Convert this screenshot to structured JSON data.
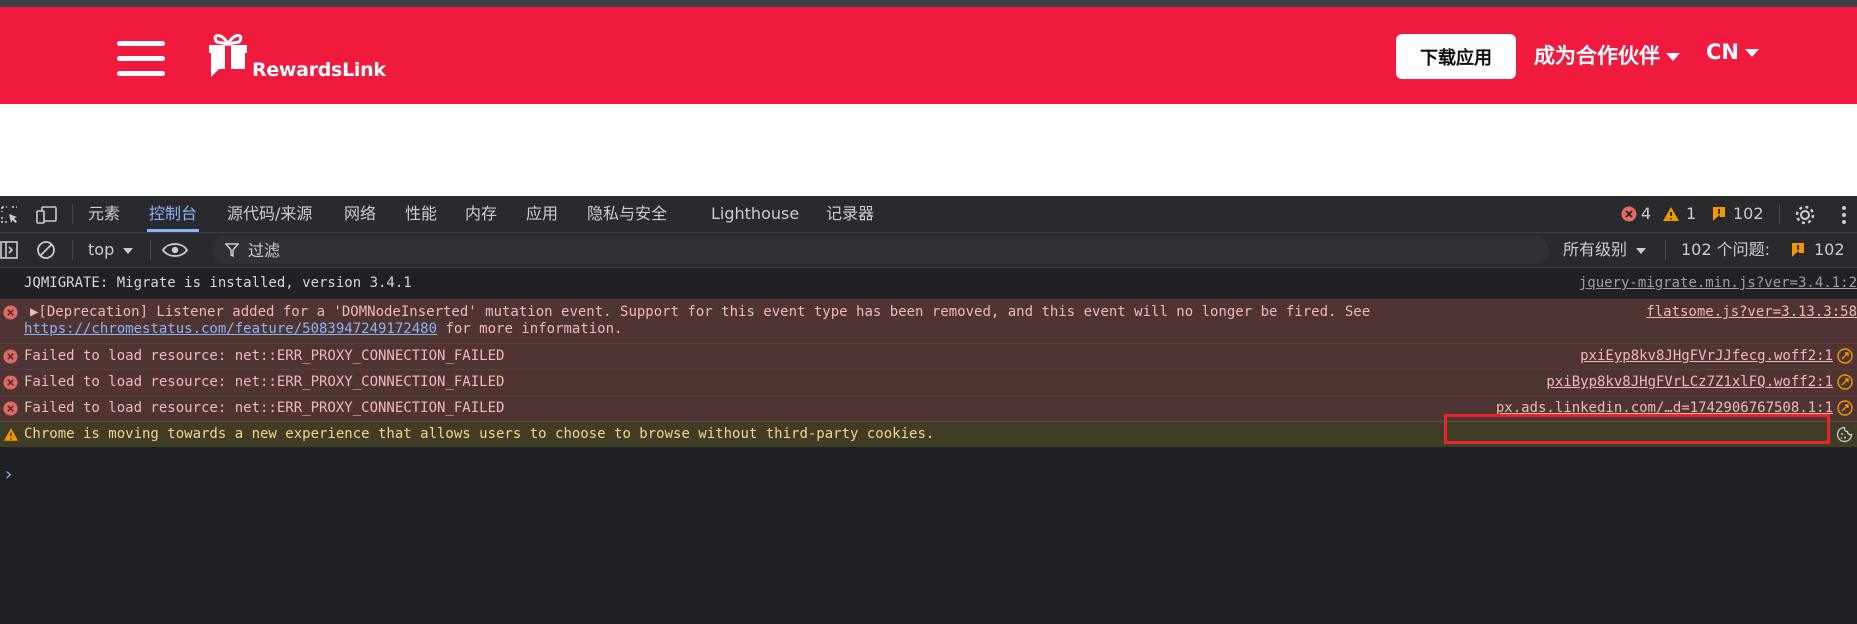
{
  "site": {
    "brand": "RewardsLink",
    "download_button": "下载应用",
    "partner_menu": "成为合作伙伴",
    "language": "CN",
    "colors": {
      "header": "#f0193e",
      "button_bg": "#ffffff"
    }
  },
  "devtools": {
    "tabs": [
      "元素",
      "控制台",
      "源代码/来源",
      "网络",
      "性能",
      "内存",
      "应用",
      "隐私与安全",
      "Lighthouse",
      "记录器"
    ],
    "active_tab": "控制台",
    "counts": {
      "errors": "4",
      "warnings": "1",
      "issues": "102"
    },
    "filterbar": {
      "context": "top",
      "filter_placeholder": "过滤",
      "level": "所有级别",
      "issues_label": "102 个问题:",
      "issues_count": "102"
    },
    "console": [
      {
        "level": "info",
        "text": "JQMIGRATE: Migrate is installed, version 3.4.1",
        "source": "jquery-migrate.min.js?ver=3.4.1:2"
      },
      {
        "level": "error",
        "text": "▶[Deprecation] Listener added for a 'DOMNodeInserted' mutation event. Support for this event type has been removed, and this event will no longer be fired. See",
        "link": "https://chromestatus.com/feature/5083947249172480",
        "after_link": " for more information.",
        "source": "flatsome.js?ver=3.13.3:58"
      },
      {
        "level": "error",
        "text": "Failed to load resource: net::ERR_PROXY_CONNECTION_FAILED",
        "source": "pxiEyp8kv8JHgFVrJJfecg.woff2:1"
      },
      {
        "level": "error",
        "text": "Failed to load resource: net::ERR_PROXY_CONNECTION_FAILED",
        "source": "pxiByp8kv8JHgFVrLCz7Z1xlFQ.woff2:1"
      },
      {
        "level": "error",
        "text": "Failed to load resource: net::ERR_PROXY_CONNECTION_FAILED",
        "source": "px.ads.linkedin.com/…d=1742906767508.1:1"
      },
      {
        "level": "warning",
        "text": "Chrome is moving towards a new experience that allows users to choose to browse without third-party cookies."
      }
    ],
    "prompt": "›",
    "colors": {
      "bg": "#202124",
      "error_row": "#4e3534",
      "warning_row": "#413c26",
      "accent": "#8ab4f8",
      "highlight": "#e8252a"
    }
  }
}
